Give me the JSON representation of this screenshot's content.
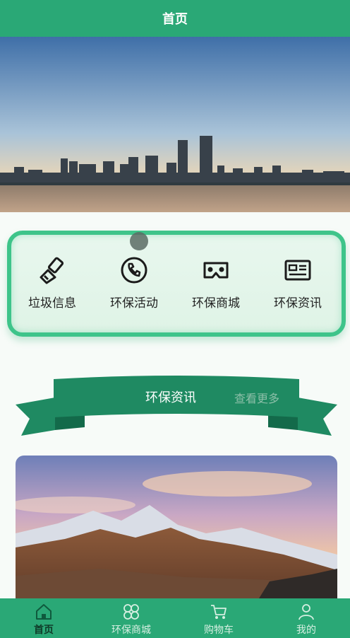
{
  "header": {
    "title": "首页"
  },
  "quick_entries": [
    {
      "label": "垃圾信息",
      "icon": "brush-icon"
    },
    {
      "label": "环保活动",
      "icon": "phone-icon"
    },
    {
      "label": "环保商城",
      "icon": "vr-glasses-icon"
    },
    {
      "label": "环保资讯",
      "icon": "id-card-icon"
    }
  ],
  "news_section": {
    "title": "环保资讯",
    "more_label": "查看更多"
  },
  "tabbar": [
    {
      "label": "首页",
      "icon": "home-icon",
      "active": true
    },
    {
      "label": "环保商城",
      "icon": "grid-icon",
      "active": false
    },
    {
      "label": "购物车",
      "icon": "cart-icon",
      "active": false
    },
    {
      "label": "我的",
      "icon": "user-icon",
      "active": false
    }
  ],
  "colors": {
    "primary": "#2aa876",
    "accent": "#3ec48a",
    "ribbon": "#1f8a62"
  }
}
